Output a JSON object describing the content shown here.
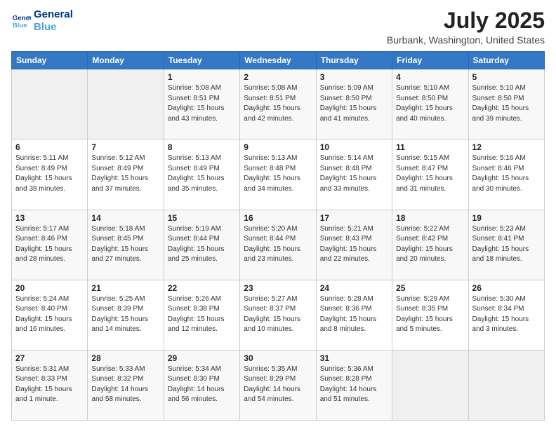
{
  "header": {
    "logo_line1": "General",
    "logo_line2": "Blue",
    "title": "July 2025",
    "subtitle": "Burbank, Washington, United States"
  },
  "weekdays": [
    "Sunday",
    "Monday",
    "Tuesday",
    "Wednesday",
    "Thursday",
    "Friday",
    "Saturday"
  ],
  "weeks": [
    [
      {
        "day": "",
        "info": ""
      },
      {
        "day": "",
        "info": ""
      },
      {
        "day": "1",
        "info": "Sunrise: 5:08 AM\nSunset: 8:51 PM\nDaylight: 15 hours and 43 minutes."
      },
      {
        "day": "2",
        "info": "Sunrise: 5:08 AM\nSunset: 8:51 PM\nDaylight: 15 hours and 42 minutes."
      },
      {
        "day": "3",
        "info": "Sunrise: 5:09 AM\nSunset: 8:50 PM\nDaylight: 15 hours and 41 minutes."
      },
      {
        "day": "4",
        "info": "Sunrise: 5:10 AM\nSunset: 8:50 PM\nDaylight: 15 hours and 40 minutes."
      },
      {
        "day": "5",
        "info": "Sunrise: 5:10 AM\nSunset: 8:50 PM\nDaylight: 15 hours and 39 minutes."
      }
    ],
    [
      {
        "day": "6",
        "info": "Sunrise: 5:11 AM\nSunset: 8:49 PM\nDaylight: 15 hours and 38 minutes."
      },
      {
        "day": "7",
        "info": "Sunrise: 5:12 AM\nSunset: 8:49 PM\nDaylight: 15 hours and 37 minutes."
      },
      {
        "day": "8",
        "info": "Sunrise: 5:13 AM\nSunset: 8:49 PM\nDaylight: 15 hours and 35 minutes."
      },
      {
        "day": "9",
        "info": "Sunrise: 5:13 AM\nSunset: 8:48 PM\nDaylight: 15 hours and 34 minutes."
      },
      {
        "day": "10",
        "info": "Sunrise: 5:14 AM\nSunset: 8:48 PM\nDaylight: 15 hours and 33 minutes."
      },
      {
        "day": "11",
        "info": "Sunrise: 5:15 AM\nSunset: 8:47 PM\nDaylight: 15 hours and 31 minutes."
      },
      {
        "day": "12",
        "info": "Sunrise: 5:16 AM\nSunset: 8:46 PM\nDaylight: 15 hours and 30 minutes."
      }
    ],
    [
      {
        "day": "13",
        "info": "Sunrise: 5:17 AM\nSunset: 8:46 PM\nDaylight: 15 hours and 28 minutes."
      },
      {
        "day": "14",
        "info": "Sunrise: 5:18 AM\nSunset: 8:45 PM\nDaylight: 15 hours and 27 minutes."
      },
      {
        "day": "15",
        "info": "Sunrise: 5:19 AM\nSunset: 8:44 PM\nDaylight: 15 hours and 25 minutes."
      },
      {
        "day": "16",
        "info": "Sunrise: 5:20 AM\nSunset: 8:44 PM\nDaylight: 15 hours and 23 minutes."
      },
      {
        "day": "17",
        "info": "Sunrise: 5:21 AM\nSunset: 8:43 PM\nDaylight: 15 hours and 22 minutes."
      },
      {
        "day": "18",
        "info": "Sunrise: 5:22 AM\nSunset: 8:42 PM\nDaylight: 15 hours and 20 minutes."
      },
      {
        "day": "19",
        "info": "Sunrise: 5:23 AM\nSunset: 8:41 PM\nDaylight: 15 hours and 18 minutes."
      }
    ],
    [
      {
        "day": "20",
        "info": "Sunrise: 5:24 AM\nSunset: 8:40 PM\nDaylight: 15 hours and 16 minutes."
      },
      {
        "day": "21",
        "info": "Sunrise: 5:25 AM\nSunset: 8:39 PM\nDaylight: 15 hours and 14 minutes."
      },
      {
        "day": "22",
        "info": "Sunrise: 5:26 AM\nSunset: 8:38 PM\nDaylight: 15 hours and 12 minutes."
      },
      {
        "day": "23",
        "info": "Sunrise: 5:27 AM\nSunset: 8:37 PM\nDaylight: 15 hours and 10 minutes."
      },
      {
        "day": "24",
        "info": "Sunrise: 5:28 AM\nSunset: 8:36 PM\nDaylight: 15 hours and 8 minutes."
      },
      {
        "day": "25",
        "info": "Sunrise: 5:29 AM\nSunset: 8:35 PM\nDaylight: 15 hours and 5 minutes."
      },
      {
        "day": "26",
        "info": "Sunrise: 5:30 AM\nSunset: 8:34 PM\nDaylight: 15 hours and 3 minutes."
      }
    ],
    [
      {
        "day": "27",
        "info": "Sunrise: 5:31 AM\nSunset: 8:33 PM\nDaylight: 15 hours and 1 minute."
      },
      {
        "day": "28",
        "info": "Sunrise: 5:33 AM\nSunset: 8:32 PM\nDaylight: 14 hours and 58 minutes."
      },
      {
        "day": "29",
        "info": "Sunrise: 5:34 AM\nSunset: 8:30 PM\nDaylight: 14 hours and 56 minutes."
      },
      {
        "day": "30",
        "info": "Sunrise: 5:35 AM\nSunset: 8:29 PM\nDaylight: 14 hours and 54 minutes."
      },
      {
        "day": "31",
        "info": "Sunrise: 5:36 AM\nSunset: 8:28 PM\nDaylight: 14 hours and 51 minutes."
      },
      {
        "day": "",
        "info": ""
      },
      {
        "day": "",
        "info": ""
      }
    ]
  ]
}
